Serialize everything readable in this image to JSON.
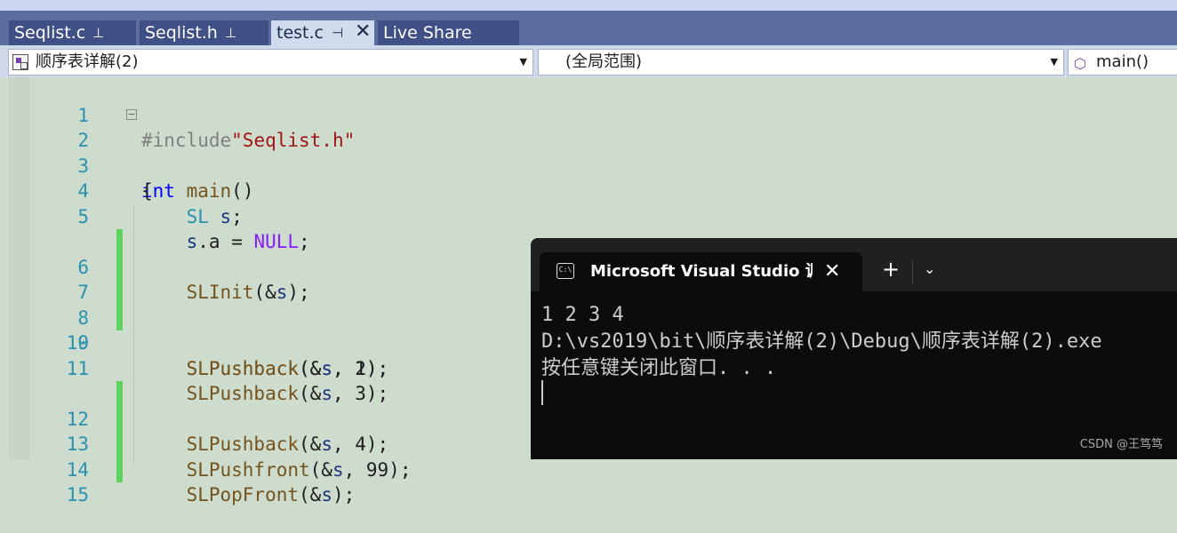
{
  "tabs": [
    {
      "label": "Seqlist.c",
      "pin": "⊥",
      "active": false
    },
    {
      "label": "Seqlist.h",
      "pin": "⊥",
      "active": false
    },
    {
      "label": "test.c",
      "pin": "⊣",
      "close": "✕",
      "active": true
    },
    {
      "label": "Live Share",
      "active": false
    }
  ],
  "navbar": {
    "project": "顺序表详解(2)",
    "scope": "(全局范围)",
    "member": "main()"
  },
  "editor": {
    "line_numbers": [
      "1",
      "2",
      "3",
      "4",
      "5",
      "6",
      "7",
      "8",
      "9",
      "10",
      "11",
      "12",
      "13",
      "14",
      "15"
    ]
  },
  "code": {
    "l1": {
      "pp": "#include",
      "str": "\"Seqlist.h\""
    },
    "l2": {
      "kw": "int",
      "sp": " ",
      "fn": "main",
      "rest": "()"
    },
    "l3": {
      "text": "{"
    },
    "l4": {
      "indent": "    ",
      "ty": "SL",
      "sp": " ",
      "var": "s",
      "rest": ";"
    },
    "l5": {
      "indent": "    ",
      "var": "s",
      "mid": ".a = ",
      "mac": "NULL",
      "rest": ";"
    },
    "l6": {
      "indent": "    ",
      "fn": "SLInit",
      "pre": "(&",
      "var": "s",
      "rest": ");"
    },
    "l9": {
      "indent": "    ",
      "fn": "SLPushback",
      "pre": "(&",
      "var": "s",
      "rest": ", 1);"
    },
    "l10": {
      "indent": "    ",
      "fn": "SLPushback",
      "pre": "(&",
      "var": "s",
      "rest": ", 2);"
    },
    "l11": {
      "indent": "    ",
      "fn": "SLPushback",
      "pre": "(&",
      "var": "s",
      "rest": ", 3);"
    },
    "l12": {
      "indent": "    ",
      "fn": "SLPushback",
      "pre": "(&",
      "var": "s",
      "rest": ", 4);"
    },
    "l13": {
      "indent": "    ",
      "fn": "SLPushfront",
      "pre": "(&",
      "var": "s",
      "rest": ", 99);"
    },
    "l14": {
      "indent": "    ",
      "fn": "SLPopFront",
      "pre": "(&",
      "var": "s",
      "rest": ");"
    }
  },
  "terminal": {
    "icon": "C:\\",
    "title": "Microsoft Visual Studio 调试控制台",
    "close": "✕",
    "plus": "+",
    "dropdown": "⌄",
    "output": [
      "1 2 3 4",
      "D:\\vs2019\\bit\\顺序表详解(2)\\Debug\\顺序表详解(2).exe",
      "按任意键关闭此窗口. . ."
    ]
  },
  "watermark": "CSDN @王笃笃",
  "colors": {
    "accent": "#5ed35e",
    "keyword": "#0000ff",
    "string": "#a31515",
    "function": "#74531f",
    "type": "#2b91af",
    "macro": "#8a1bff"
  }
}
